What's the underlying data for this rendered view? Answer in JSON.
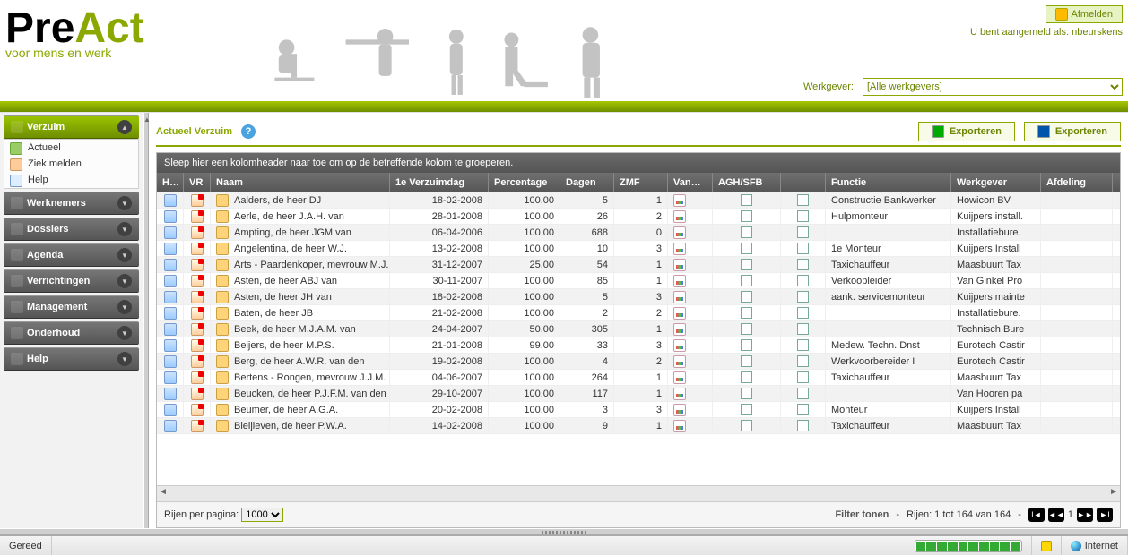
{
  "header": {
    "logo_pre": "Pre",
    "logo_act": "Act",
    "logo_sub": "voor mens en werk",
    "logout": "Afmelden",
    "logged_as_prefix": "U bent aangemeld als: ",
    "username": "nbeurskens",
    "werkgever_label": "Werkgever:",
    "werkgever_value": "[Alle werkgevers]"
  },
  "sidebar": {
    "sections": [
      {
        "label": "Verzuim",
        "active": true,
        "items": [
          {
            "label": "Actueel",
            "icon": "current"
          },
          {
            "label": "Ziek melden",
            "icon": "sick"
          },
          {
            "label": "Help",
            "icon": "help"
          }
        ]
      },
      {
        "label": "Werknemers"
      },
      {
        "label": "Dossiers"
      },
      {
        "label": "Agenda"
      },
      {
        "label": "Verrichtingen"
      },
      {
        "label": "Management"
      },
      {
        "label": "Onderhoud"
      },
      {
        "label": "Help"
      }
    ]
  },
  "page": {
    "title": "Actueel Verzuim",
    "export_excel": "Exporteren",
    "export_word": "Exporteren",
    "groupbar": "Sleep hier een kolomheader naar toe om op de betreffende kolom te groeperen.",
    "columns": {
      "hm": "HM",
      "vr": "VR",
      "naam": "Naam",
      "date": "1e Verzuimdag",
      "perc": "Percentage",
      "dag": "Dagen",
      "zmf": "ZMF",
      "vang": "Vangnet",
      "agh": "AGH/SFB",
      "functie": "Functie",
      "werkgever": "Werkgever",
      "afdeling": "Afdeling"
    },
    "rows": [
      {
        "naam": "Aalders, de heer DJ",
        "date": "18-02-2008",
        "perc": "100.00",
        "dag": "5",
        "zmf": "1",
        "functie": "Constructie Bankwerker",
        "werkgever": "Howicon BV",
        "afdeling": ""
      },
      {
        "naam": "Aerle, de heer J.A.H. van",
        "date": "28-01-2008",
        "perc": "100.00",
        "dag": "26",
        "zmf": "2",
        "functie": "Hulpmonteur",
        "werkgever": "Kuijpers install.",
        "afdeling": ""
      },
      {
        "naam": "Ampting, de heer JGM van",
        "date": "06-04-2006",
        "perc": "100.00",
        "dag": "688",
        "zmf": "0",
        "functie": "",
        "werkgever": "Installatiebure.",
        "afdeling": ""
      },
      {
        "naam": "Angelentina, de heer W.J.",
        "date": "13-02-2008",
        "perc": "100.00",
        "dag": "10",
        "zmf": "3",
        "functie": "1e Monteur",
        "werkgever": "Kuijpers Install",
        "afdeling": ""
      },
      {
        "naam": "Arts - Paardenkoper, mevrouw M.J.",
        "date": "31-12-2007",
        "perc": "25.00",
        "dag": "54",
        "zmf": "1",
        "functie": "Taxichauffeur",
        "werkgever": "Maasbuurt Tax",
        "afdeling": ""
      },
      {
        "naam": "Asten, de heer ABJ van",
        "date": "30-11-2007",
        "perc": "100.00",
        "dag": "85",
        "zmf": "1",
        "functie": "Verkoopleider",
        "werkgever": "Van Ginkel Pro",
        "afdeling": ""
      },
      {
        "naam": "Asten, de heer JH van",
        "date": "18-02-2008",
        "perc": "100.00",
        "dag": "5",
        "zmf": "3",
        "functie": "aank. servicemonteur",
        "werkgever": "Kuijpers mainte",
        "afdeling": ""
      },
      {
        "naam": "Baten, de heer JB",
        "date": "21-02-2008",
        "perc": "100.00",
        "dag": "2",
        "zmf": "2",
        "functie": "",
        "werkgever": "Installatiebure.",
        "afdeling": ""
      },
      {
        "naam": "Beek, de heer M.J.A.M. van",
        "date": "24-04-2007",
        "perc": "50.00",
        "dag": "305",
        "zmf": "1",
        "functie": "",
        "werkgever": "Technisch Bure",
        "afdeling": ""
      },
      {
        "naam": "Beijers, de heer M.P.S.",
        "date": "21-01-2008",
        "perc": "99.00",
        "dag": "33",
        "zmf": "3",
        "functie": "Medew. Techn. Dnst",
        "werkgever": "Eurotech Castir",
        "afdeling": ""
      },
      {
        "naam": "Berg, de heer A.W.R. van den",
        "date": "19-02-2008",
        "perc": "100.00",
        "dag": "4",
        "zmf": "2",
        "functie": "Werkvoorbereider I",
        "werkgever": "Eurotech Castir",
        "afdeling": ""
      },
      {
        "naam": "Bertens - Rongen, mevrouw J.J.M.",
        "date": "04-06-2007",
        "perc": "100.00",
        "dag": "264",
        "zmf": "1",
        "functie": "Taxichauffeur",
        "werkgever": "Maasbuurt Tax",
        "afdeling": ""
      },
      {
        "naam": "Beucken, de heer P.J.F.M. van den",
        "date": "29-10-2007",
        "perc": "100.00",
        "dag": "117",
        "zmf": "1",
        "functie": "",
        "werkgever": "Van Hooren pa",
        "afdeling": ""
      },
      {
        "naam": "Beumer, de heer A.G.A.",
        "date": "20-02-2008",
        "perc": "100.00",
        "dag": "3",
        "zmf": "3",
        "functie": "Monteur",
        "werkgever": "Kuijpers Install",
        "afdeling": ""
      },
      {
        "naam": "Bleijleven, de heer P.W.A.",
        "date": "14-02-2008",
        "perc": "100.00",
        "dag": "9",
        "zmf": "1",
        "functie": "Taxichauffeur",
        "werkgever": "Maasbuurt Tax",
        "afdeling": ""
      }
    ],
    "footer": {
      "rpp_label": "Rijen per pagina:",
      "rpp_value": "1000",
      "filter": "Filter tonen",
      "summary": "Rijen: 1 tot 164 van 164",
      "page": "1"
    }
  },
  "status": {
    "ready": "Gereed",
    "zone": "Internet"
  }
}
